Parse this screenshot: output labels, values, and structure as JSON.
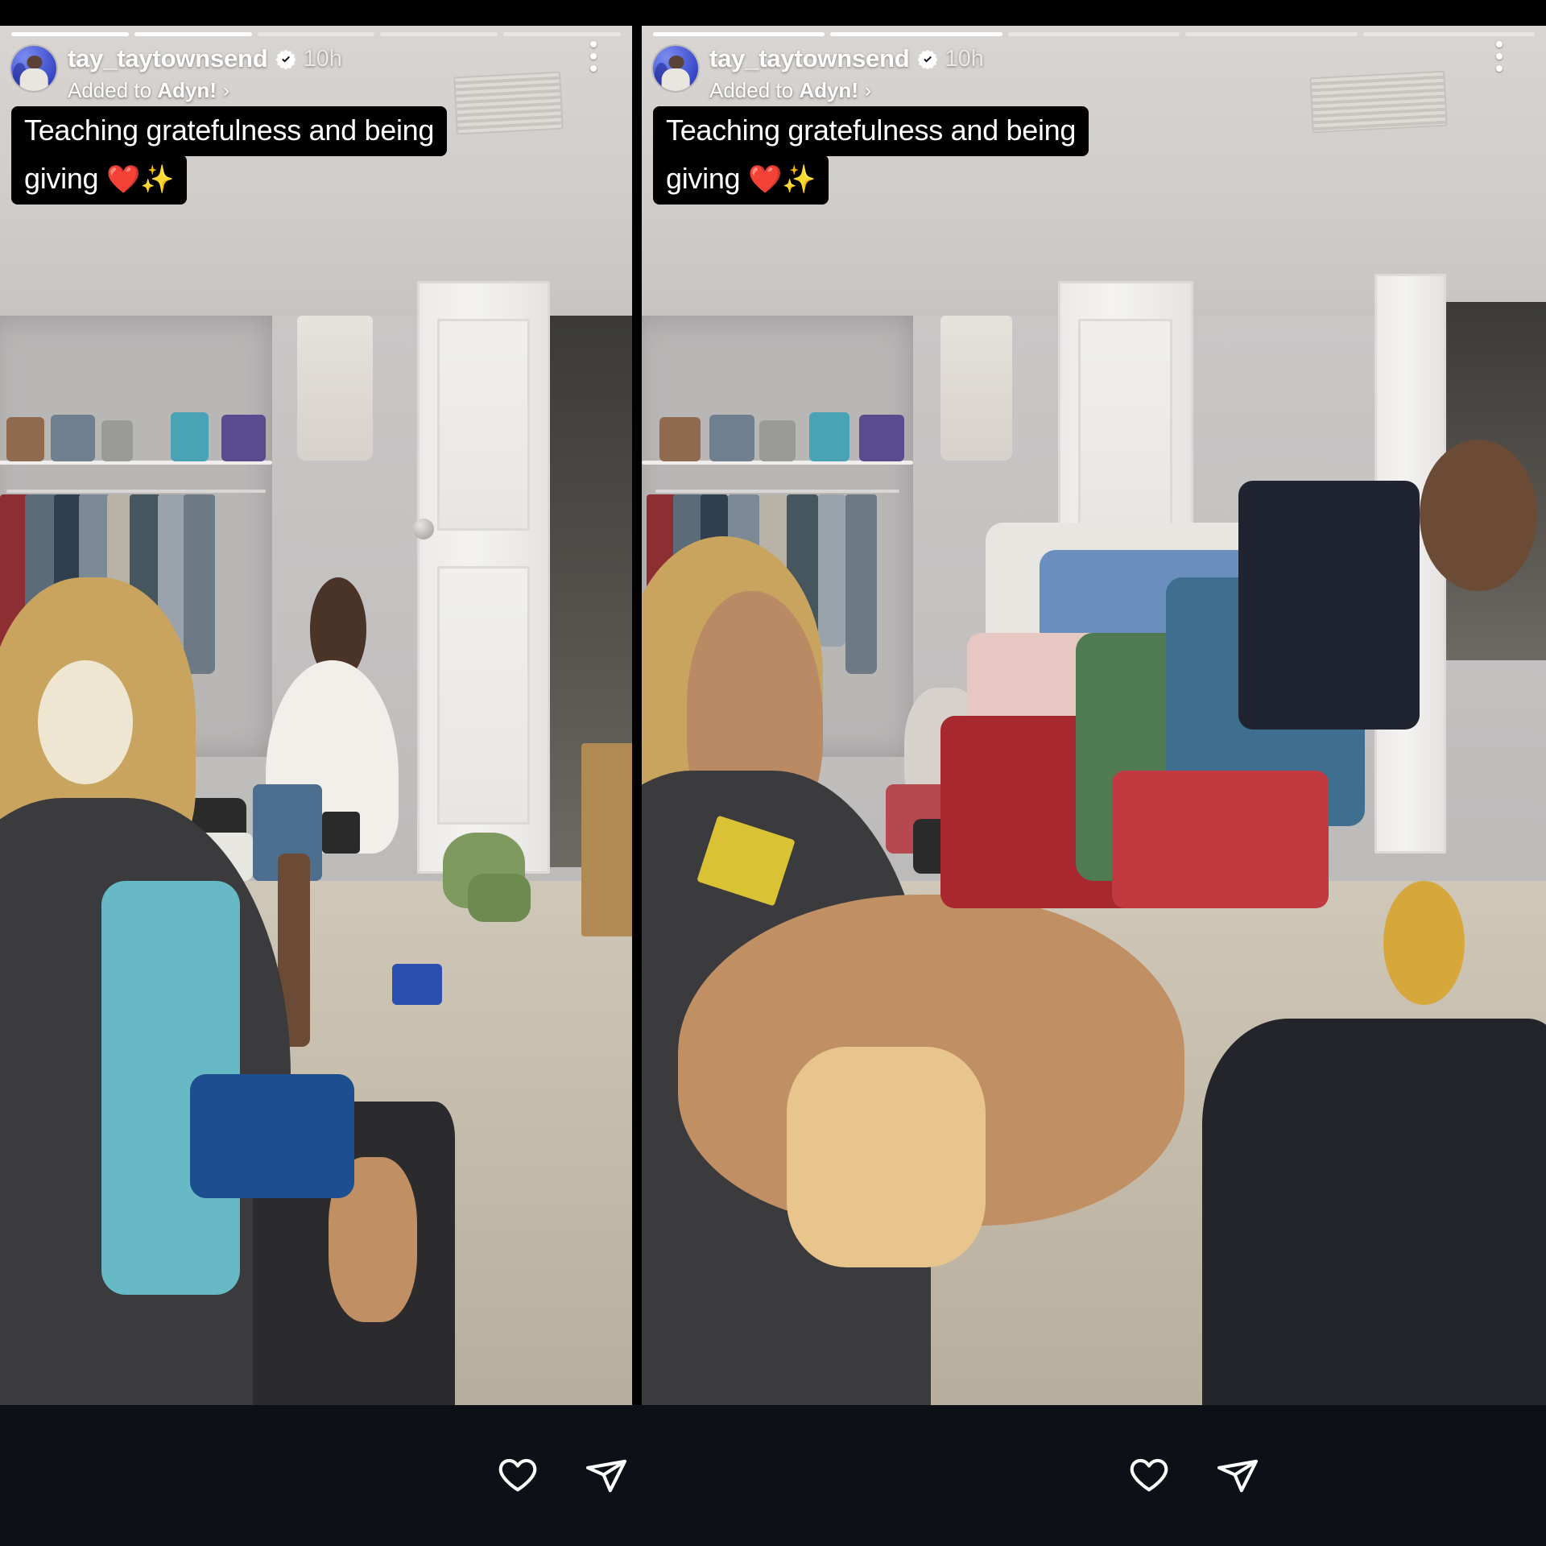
{
  "app": "instagram-story-viewer",
  "layout": {
    "panel_count": 2,
    "canvas_bg": "#000000",
    "actionbar_bg": "#0d1117"
  },
  "story": {
    "username": "tay_taytownsend",
    "verified": true,
    "verified_icon": "verified-badge-icon",
    "timestamp": "10h",
    "added_to_prefix": "Added to ",
    "added_to_highlight": "Adyn!",
    "added_to_chevron": "›",
    "caption_line_1": "Teaching gratefulness and being",
    "caption_line_2": "giving ",
    "caption_emoji": "❤️✨",
    "caption_bg": "#000000",
    "caption_color": "#ffffff",
    "menu_icon": "more-options-kebab-icon",
    "avatar_icon": "profile-avatar"
  },
  "progress": {
    "segments": 5,
    "filled": [
      true,
      true,
      false,
      false,
      false
    ],
    "filled_color": "#ffffff",
    "empty_color": "rgba(255,255,255,0.42)"
  },
  "actions": {
    "like_label": "Like",
    "like_icon": "heart-icon",
    "share_label": "Share",
    "share_icon": "paper-plane-send-icon",
    "icon_color": "#ffffff"
  },
  "panels": [
    {
      "id": "panel-left",
      "scene_description": "Woman with blonde ponytail kneeling beside toddler boy in bedroom with open closet and white door"
    },
    {
      "id": "panel-right",
      "scene_description": "Woman in dark graphic tee handing a stack of folded clothes toward child near closet"
    }
  ]
}
